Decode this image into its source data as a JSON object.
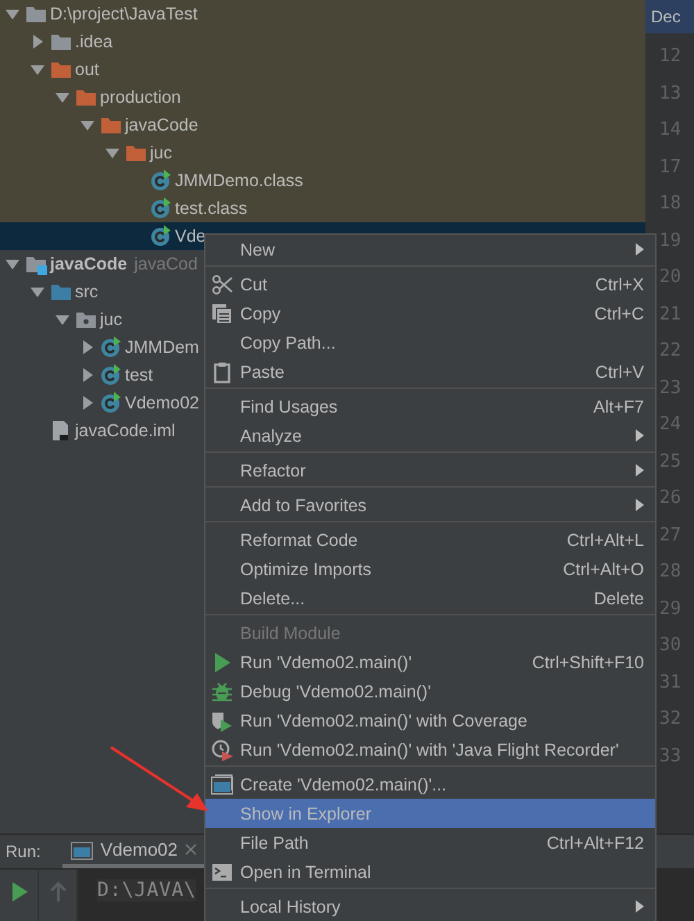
{
  "tree": [
    {
      "label": "D:\\project\\JavaTest",
      "kind": "folder",
      "expanded": true,
      "highlighted": true,
      "selected": false,
      "children": [
        {
          "label": ".idea",
          "kind": "folder",
          "expanded": false,
          "highlighted": true,
          "selected": false
        },
        {
          "label": "out",
          "kind": "excluded",
          "expanded": true,
          "highlighted": true,
          "selected": false,
          "children": [
            {
              "label": "production",
              "kind": "excluded",
              "expanded": true,
              "highlighted": true,
              "selected": false,
              "children": [
                {
                  "label": "javaCode",
                  "kind": "excluded",
                  "expanded": true,
                  "highlighted": true,
                  "selected": false,
                  "children": [
                    {
                      "label": "juc",
                      "kind": "excluded",
                      "expanded": true,
                      "highlighted": true,
                      "selected": false,
                      "children": [
                        {
                          "label": "JMMDemo.class",
                          "kind": "class",
                          "highlighted": true,
                          "selected": false
                        },
                        {
                          "label": "test.class",
                          "kind": "class",
                          "highlighted": true,
                          "selected": false
                        },
                        {
                          "label": "Vde",
                          "kind": "class",
                          "highlighted": false,
                          "selected": true
                        }
                      ]
                    }
                  ]
                }
              ]
            }
          ]
        }
      ]
    },
    {
      "label": "javaCode",
      "secondary": "javaCod",
      "kind": "module",
      "expanded": true,
      "highlighted": false,
      "selected": false,
      "children": [
        {
          "label": "src",
          "kind": "source",
          "expanded": true,
          "highlighted": false,
          "selected": false,
          "children": [
            {
              "label": "juc",
              "kind": "package",
              "expanded": true,
              "highlighted": false,
              "selected": false,
              "children": [
                {
                  "label": "JMMDem",
                  "kind": "java",
                  "expanded": false,
                  "highlighted": false,
                  "selected": false
                },
                {
                  "label": "test",
                  "kind": "java",
                  "expanded": false,
                  "highlighted": false,
                  "selected": false
                },
                {
                  "label": "Vdemo02",
                  "kind": "java",
                  "expanded": false,
                  "highlighted": false,
                  "selected": false
                }
              ]
            }
          ]
        },
        {
          "label": "javaCode.iml",
          "kind": "iml",
          "highlighted": false,
          "selected": false
        }
      ]
    }
  ],
  "editor": {
    "tab": "Dec",
    "line_numbers": [
      "12",
      "13",
      "14",
      "17",
      "18",
      "19",
      "20",
      "21",
      "22",
      "23",
      "24",
      "25",
      "26",
      "27",
      "28",
      "29",
      "30",
      "31",
      "32",
      "33"
    ]
  },
  "run_panel": {
    "label": "Run:",
    "tabs": [
      {
        "label": "Vdemo02",
        "selected": true
      }
    ],
    "console": "D:\\JAVA\\"
  },
  "context_menu": {
    "groups": [
      [
        {
          "label": "New",
          "submenu": true,
          "disabled": false,
          "selected": false
        }
      ],
      [
        {
          "label": "Cut",
          "shortcut": "Ctrl+X",
          "disabled": false,
          "selected": false
        },
        {
          "label": "Copy",
          "shortcut": "Ctrl+C",
          "disabled": false,
          "selected": false
        },
        {
          "label": "Copy Path...",
          "disabled": false,
          "selected": false
        },
        {
          "label": "Paste",
          "shortcut": "Ctrl+V",
          "disabled": false,
          "selected": false
        }
      ],
      [
        {
          "label": "Find Usages",
          "shortcut": "Alt+F7",
          "disabled": false,
          "selected": false
        },
        {
          "label": "Analyze",
          "submenu": true,
          "disabled": false,
          "selected": false
        }
      ],
      [
        {
          "label": "Refactor",
          "submenu": true,
          "disabled": false,
          "selected": false
        }
      ],
      [
        {
          "label": "Add to Favorites",
          "submenu": true,
          "disabled": false,
          "selected": false
        }
      ],
      [
        {
          "label": "Reformat Code",
          "shortcut": "Ctrl+Alt+L",
          "disabled": false,
          "selected": false
        },
        {
          "label": "Optimize Imports",
          "shortcut": "Ctrl+Alt+O",
          "disabled": false,
          "selected": false
        },
        {
          "label": "Delete...",
          "shortcut": "Delete",
          "disabled": false,
          "selected": false
        }
      ],
      [
        {
          "label": "Build Module",
          "disabled": true,
          "selected": false
        },
        {
          "label": "Run 'Vdemo02.main()'",
          "shortcut": "Ctrl+Shift+F10",
          "disabled": false,
          "selected": false
        },
        {
          "label": "Debug 'Vdemo02.main()'",
          "disabled": false,
          "selected": false
        },
        {
          "label": "Run 'Vdemo02.main()' with Coverage",
          "disabled": false,
          "selected": false
        },
        {
          "label": "Run 'Vdemo02.main()' with 'Java Flight Recorder'",
          "disabled": false,
          "selected": false
        }
      ],
      [
        {
          "label": "Create 'Vdemo02.main()'...",
          "disabled": false,
          "selected": false
        },
        {
          "label": "Show in Explorer",
          "disabled": false,
          "selected": true
        },
        {
          "label": "File Path",
          "shortcut": "Ctrl+Alt+F12",
          "disabled": false,
          "selected": false
        },
        {
          "label": "Open in Terminal",
          "disabled": false,
          "selected": false
        }
      ],
      [
        {
          "label": "Local History",
          "submenu": true,
          "disabled": false,
          "selected": false
        }
      ]
    ]
  }
}
